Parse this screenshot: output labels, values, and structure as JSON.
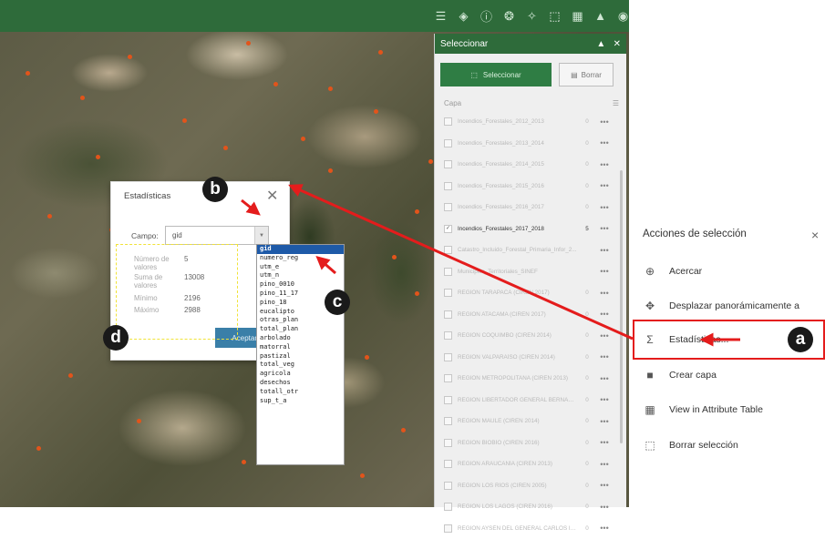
{
  "toolbar": {
    "icons": [
      "list-icon",
      "layers-icon",
      "info-icon",
      "sliders-icon",
      "shapes-icon",
      "select-icon",
      "table-icon",
      "map-icon",
      "gauge-icon"
    ]
  },
  "select_panel": {
    "title": "Seleccionar",
    "select_button": "Seleccionar",
    "clear_button": "Borrar",
    "layer_header": "Capa",
    "layers": [
      {
        "name": "Incendios_Forestales_2012_2013",
        "count": "0",
        "checked": false
      },
      {
        "name": "Incendios_Forestales_2013_2014",
        "count": "0",
        "checked": false
      },
      {
        "name": "Incendios_Forestales_2014_2015",
        "count": "0",
        "checked": false
      },
      {
        "name": "Incendios_Forestales_2015_2016",
        "count": "0",
        "checked": false
      },
      {
        "name": "Incendios_Forestales_2016_2017",
        "count": "0",
        "checked": false
      },
      {
        "name": "Incendios_Forestales_2017_2018",
        "count": "5",
        "checked": true
      },
      {
        "name": "Catastro_Incluido_Forestal_Primaria_Infor_2...",
        "count": "",
        "checked": false
      },
      {
        "name": "Municipios_Territoriales_SINEF",
        "count": "",
        "checked": false
      },
      {
        "name": "REGIÓN TARAPACÁ (CIREN 2017)",
        "count": "0",
        "checked": false
      },
      {
        "name": "REGIÓN ATACAMA (CIREN 2017)",
        "count": "0",
        "checked": false
      },
      {
        "name": "REGIÓN COQUIMBO (CIREN 2014)",
        "count": "0",
        "checked": false
      },
      {
        "name": "REGIÓN VALPARAÍSO (CIREN 2014)",
        "count": "0",
        "checked": false
      },
      {
        "name": "REGIÓN METROPOLITANA (CIREN 2013)",
        "count": "0",
        "checked": false
      },
      {
        "name": "REGIÓN LIBERTADOR GENERAL BERNARD...",
        "count": "0",
        "checked": false
      },
      {
        "name": "REGIÓN MAULE (CIREN 2014)",
        "count": "0",
        "checked": false
      },
      {
        "name": "REGIÓN BIOBÍO (CIREN 2016)",
        "count": "0",
        "checked": false
      },
      {
        "name": "REGIÓN ARAUCANÍA (CIREN 2013)",
        "count": "0",
        "checked": false
      },
      {
        "name": "REGIÓN LOS RÍOS (CIREN 2005)",
        "count": "0",
        "checked": false
      },
      {
        "name": "REGIÓN LOS LAGOS (CIREN 2016)",
        "count": "0",
        "checked": false
      },
      {
        "name": "REGIÓN AYSÉN DEL GENERAL CARLOS IBA...",
        "count": "0",
        "checked": false
      }
    ],
    "more": "•••"
  },
  "actions_panel": {
    "title": "Acciones de selección",
    "close": "×",
    "items": [
      {
        "label": "Acercar",
        "icon": "zoom-to-icon"
      },
      {
        "label": "Desplazar panorámicamente a",
        "icon": "pan-to-icon"
      },
      {
        "label": "Estadísticas...",
        "icon": "sigma-icon"
      },
      {
        "label": "Crear capa",
        "icon": "create-layer-icon"
      },
      {
        "label": "View in Attribute Table",
        "icon": "table-icon"
      },
      {
        "label": "Borrar selección",
        "icon": "clear-selection-icon"
      }
    ]
  },
  "stats_dialog": {
    "title": "Estadísticas",
    "close": "✕",
    "field_label": "Campo:",
    "field_value": "gid",
    "stats": [
      {
        "label": "Número de valores",
        "value": "5"
      },
      {
        "label": "Suma de valores",
        "value": "13008"
      },
      {
        "label": "Mínimo",
        "value": "2196"
      },
      {
        "label": "Máximo",
        "value": "2988"
      }
    ],
    "accept_button": "Aceptar"
  },
  "field_options": [
    "gid",
    "numero_reg",
    "utm_e",
    "utm_n",
    "pino_0010",
    "pino_11_17",
    "pino_18",
    "eucalipto",
    "otras_plan",
    "total_plan",
    "arbolado",
    "matorral",
    "pastizal",
    "total_veg",
    "agricola",
    "desechos",
    "totall_otr",
    "sup_t_a"
  ],
  "callouts": {
    "a": "a",
    "b": "b",
    "c": "c",
    "d": "d"
  },
  "colors": {
    "accent_green": "#2e6b3a",
    "annotation_red": "#e41c1c",
    "annotation_yellow": "#f1e338"
  }
}
